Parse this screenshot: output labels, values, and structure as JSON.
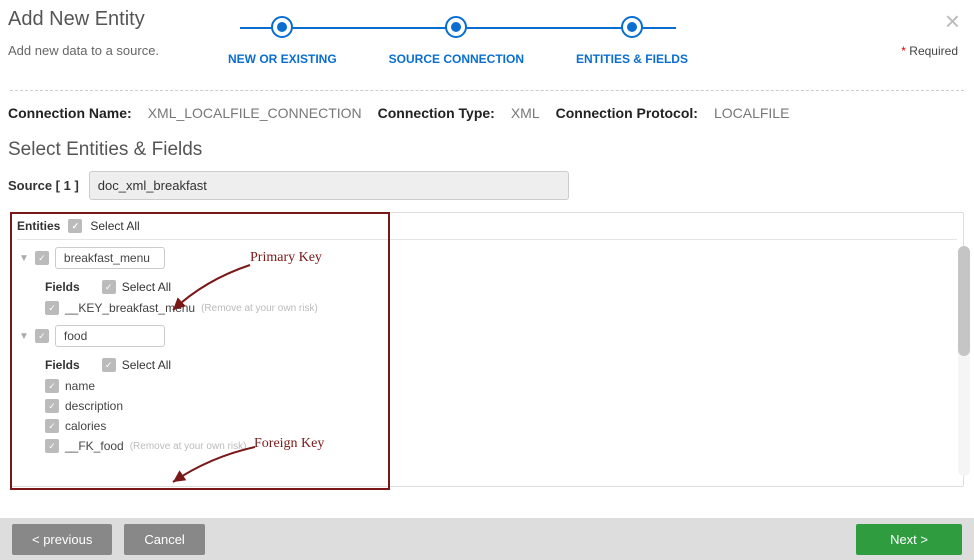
{
  "header": {
    "title": "Add New Entity",
    "subtitle": "Add new data to a source.",
    "required_label": "Required"
  },
  "stepper": {
    "steps": [
      {
        "label": "NEW OR EXISTING"
      },
      {
        "label": "SOURCE CONNECTION"
      },
      {
        "label": "ENTITIES & FIELDS"
      }
    ]
  },
  "connection": {
    "name_label": "Connection Name:",
    "name_value": "XML_LOCALFILE_CONNECTION",
    "type_label": "Connection Type:",
    "type_value": "XML",
    "protocol_label": "Connection Protocol:",
    "protocol_value": "LOCALFILE"
  },
  "section_title": "Select Entities & Fields",
  "source": {
    "label": "Source [ 1 ]",
    "value": "doc_xml_breakfast"
  },
  "entities": {
    "header_label": "Entities",
    "select_all_label": "Select All",
    "list": [
      {
        "name": "breakfast_menu",
        "fields_label": "Fields",
        "select_all_label": "Select All",
        "fields": [
          {
            "name": "__KEY_breakfast_menu",
            "hint": "(Remove at your own risk)"
          }
        ]
      },
      {
        "name": "food",
        "fields_label": "Fields",
        "select_all_label": "Select All",
        "fields": [
          {
            "name": "name"
          },
          {
            "name": "description"
          },
          {
            "name": "calories"
          },
          {
            "name": "__FK_food",
            "hint": "(Remove at your own risk)"
          }
        ]
      }
    ]
  },
  "annotations": {
    "primary_key": "Primary Key",
    "foreign_key": "Foreign Key"
  },
  "footer": {
    "prev": "< previous",
    "cancel": "Cancel",
    "next": "Next >"
  }
}
